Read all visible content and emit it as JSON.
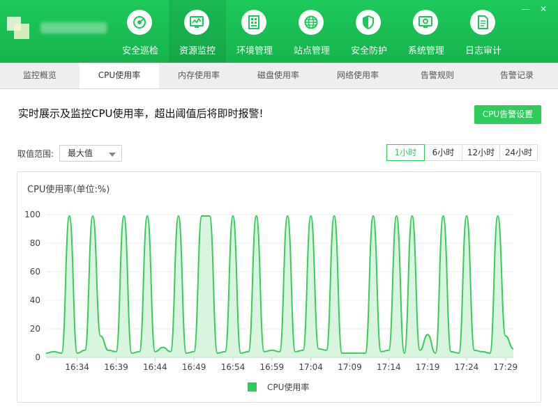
{
  "header": {
    "window_controls": [
      "—",
      "✕"
    ],
    "nav": [
      {
        "label": "安全巡检",
        "icon": "radar-icon"
      },
      {
        "label": "资源监控",
        "icon": "monitor-chart-icon",
        "active": true
      },
      {
        "label": "环境管理",
        "icon": "server-rack-icon"
      },
      {
        "label": "站点管理",
        "icon": "globe-icon"
      },
      {
        "label": "安全防护",
        "icon": "shield-icon"
      },
      {
        "label": "系统管理",
        "icon": "settings-monitor-icon"
      },
      {
        "label": "日志审计",
        "icon": "document-icon"
      }
    ]
  },
  "subtabs": [
    {
      "label": "监控概览"
    },
    {
      "label": "CPU使用率",
      "active": true
    },
    {
      "label": "内存使用率"
    },
    {
      "label": "磁盘使用率"
    },
    {
      "label": "网络使用率"
    },
    {
      "label": "告警规则"
    },
    {
      "label": "告警记录"
    }
  ],
  "content": {
    "description": "实时展示及监控CPU使用率，超出阈值后将即时报警!",
    "alarm_button": "CPU告警设置",
    "range_label": "取值范围:",
    "range_value": "最大值",
    "time_buttons": [
      {
        "label": "1小时",
        "active": true
      },
      {
        "label": "6小时"
      },
      {
        "label": "12小时"
      },
      {
        "label": "24小时"
      }
    ]
  },
  "colors": {
    "brand_green": "#1dc85a",
    "accent_green": "#2fcb5d",
    "line": "#3cc95e",
    "fill": "#c9f0d2"
  },
  "chart_data": {
    "type": "area",
    "title": "CPU使用率(单位:%)",
    "xlabel": "",
    "ylabel": "",
    "ylim": [
      0,
      100
    ],
    "yticks": [
      0,
      20,
      40,
      60,
      80,
      100
    ],
    "xlim_minutes": [
      0,
      60
    ],
    "xticks": [
      {
        "t": 4,
        "label": "16:34"
      },
      {
        "t": 9,
        "label": "16:39"
      },
      {
        "t": 14,
        "label": "16:44"
      },
      {
        "t": 19,
        "label": "16:49"
      },
      {
        "t": 24,
        "label": "16:54"
      },
      {
        "t": 29,
        "label": "16:59"
      },
      {
        "t": 34,
        "label": "17:04"
      },
      {
        "t": 39,
        "label": "17:09"
      },
      {
        "t": 44,
        "label": "17:14"
      },
      {
        "t": 49,
        "label": "17:19"
      },
      {
        "t": 54,
        "label": "17:24"
      },
      {
        "t": 59,
        "label": "17:29"
      }
    ],
    "legend": "CPU使用率",
    "grid": true,
    "series": [
      {
        "name": "CPU使用率",
        "points": [
          [
            0,
            3
          ],
          [
            1,
            4
          ],
          [
            2,
            3
          ],
          [
            3,
            99
          ],
          [
            4,
            3
          ],
          [
            5,
            5
          ],
          [
            6,
            99
          ],
          [
            7,
            15
          ],
          [
            8,
            5
          ],
          [
            9,
            4
          ],
          [
            10,
            99
          ],
          [
            11,
            3
          ],
          [
            12,
            4
          ],
          [
            13,
            99
          ],
          [
            14,
            4
          ],
          [
            15,
            7
          ],
          [
            16,
            4
          ],
          [
            17,
            99
          ],
          [
            18,
            3
          ],
          [
            19,
            4
          ],
          [
            20,
            99
          ],
          [
            21,
            99
          ],
          [
            22,
            3
          ],
          [
            23,
            4
          ],
          [
            24,
            99
          ],
          [
            25,
            3
          ],
          [
            26,
            4
          ],
          [
            27,
            99
          ],
          [
            28,
            4
          ],
          [
            29,
            5
          ],
          [
            30,
            4
          ],
          [
            31,
            99
          ],
          [
            32,
            4
          ],
          [
            33,
            5
          ],
          [
            34,
            99
          ],
          [
            35,
            6
          ],
          [
            36,
            5
          ],
          [
            37,
            99
          ],
          [
            38,
            3
          ],
          [
            39,
            3
          ],
          [
            40,
            3
          ],
          [
            41,
            3
          ],
          [
            42,
            99
          ],
          [
            43,
            4
          ],
          [
            44,
            5
          ],
          [
            45,
            99
          ],
          [
            46,
            3
          ],
          [
            47,
            99
          ],
          [
            48,
            5
          ],
          [
            49,
            16
          ],
          [
            50,
            3
          ],
          [
            51,
            99
          ],
          [
            52,
            4
          ],
          [
            53,
            3
          ],
          [
            54,
            99
          ],
          [
            55,
            5
          ],
          [
            56,
            4
          ],
          [
            57,
            3
          ],
          [
            58,
            99
          ],
          [
            59,
            15
          ],
          [
            60,
            6
          ]
        ]
      }
    ]
  }
}
